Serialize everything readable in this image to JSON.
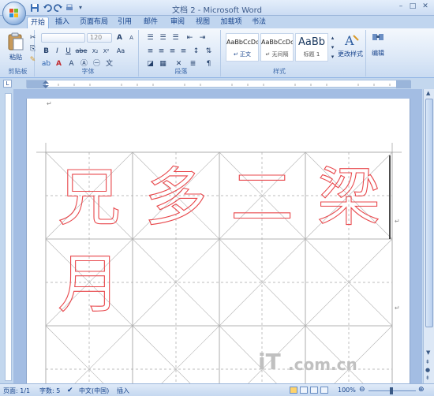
{
  "window": {
    "title": "文档 2 - Microsoft Word",
    "controls": [
      "–",
      "□",
      "✕"
    ]
  },
  "tabs": [
    {
      "label": "开始",
      "active": true
    },
    {
      "label": "插入"
    },
    {
      "label": "页面布局"
    },
    {
      "label": "引用"
    },
    {
      "label": "邮件"
    },
    {
      "label": "审阅"
    },
    {
      "label": "视图"
    },
    {
      "label": "加载项"
    },
    {
      "label": "书法"
    }
  ],
  "ribbon": {
    "clipboard": {
      "paste_label": "粘贴",
      "group_label": "剪贴板"
    },
    "font": {
      "font_name": "",
      "font_size": "120",
      "group_label": "字体",
      "bold": "B",
      "italic": "I",
      "underline": "U",
      "strike": "abe",
      "sub": "X₂",
      "sup": "X²",
      "aa": "Aa",
      "grow": "A",
      "shrink": "A"
    },
    "paragraph": {
      "group_label": "段落"
    },
    "styles": {
      "group_label": "样式",
      "items": [
        {
          "sample": "AaBbCcDc",
          "name": "↵ 正文"
        },
        {
          "sample": "AaBbCcDc",
          "name": "↵ 无间隔"
        },
        {
          "sample": "AaBb",
          "name": "标题 1"
        }
      ],
      "change_styles_label": "更改样式"
    },
    "editing": {
      "label": "编辑"
    }
  },
  "document": {
    "characters": [
      "兄",
      "多",
      "二",
      "梁",
      "月"
    ]
  },
  "statusbar": {
    "page": "页面: 1/1",
    "words": "字数: 5",
    "language": "中文(中国)",
    "mode": "插入",
    "zoom": "100%"
  },
  "watermark": {
    "text1": "iT",
    "text2": ".com.cn"
  },
  "colors": {
    "accent": "#15428b",
    "ribbon_bg": "#dce8f7",
    "char_outline": "#e8474b",
    "grid": "#a0a0a0"
  }
}
